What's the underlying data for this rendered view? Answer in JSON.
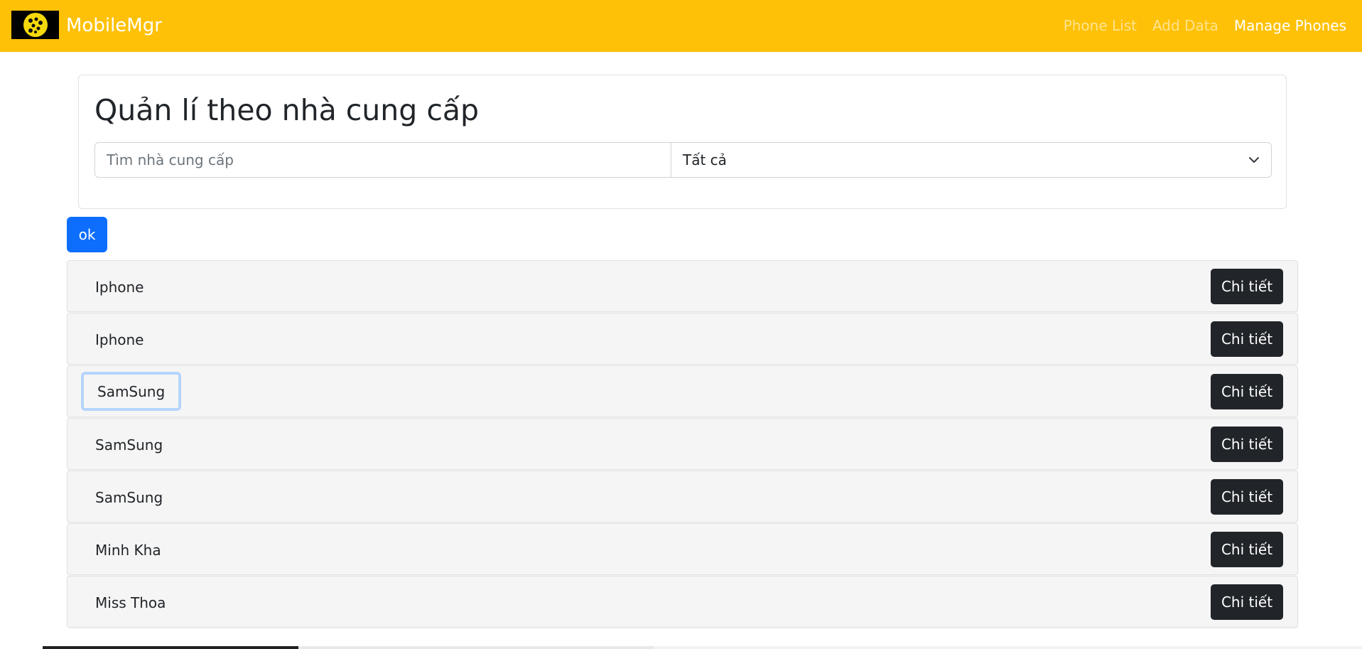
{
  "navbar": {
    "brand": "MobileMgr",
    "logo_icon": "phone-dots-logo-icon",
    "links": [
      {
        "label": "Phone List",
        "active": false
      },
      {
        "label": "Add Data",
        "active": false
      },
      {
        "label": "Manage Phones",
        "active": true
      }
    ]
  },
  "filter": {
    "title": "Quản lí theo nhà cung cấp",
    "search_placeholder": "Tìm nhà cung cấp",
    "search_value": "",
    "select_value": "Tất cả",
    "select_icon": "chevron-down-icon"
  },
  "ok_label": "ok",
  "providers": [
    {
      "name": "Iphone",
      "button": "Chi tiết"
    },
    {
      "name": "Iphone",
      "button": "Chi tiết"
    },
    {
      "name": "SamSung",
      "button": "Chi tiết"
    },
    {
      "name": "SamSung",
      "button": "Chi tiết"
    },
    {
      "name": "SamSung",
      "button": "Chi tiết"
    },
    {
      "name": "Minh Kha",
      "button": "Chi tiết"
    },
    {
      "name": "Miss Thoa",
      "button": "Chi tiết"
    }
  ],
  "colors": {
    "navbar": "#ffc107",
    "primary": "#0d6efd",
    "dark": "#212529",
    "focus_ring": "#b6d4fe"
  }
}
